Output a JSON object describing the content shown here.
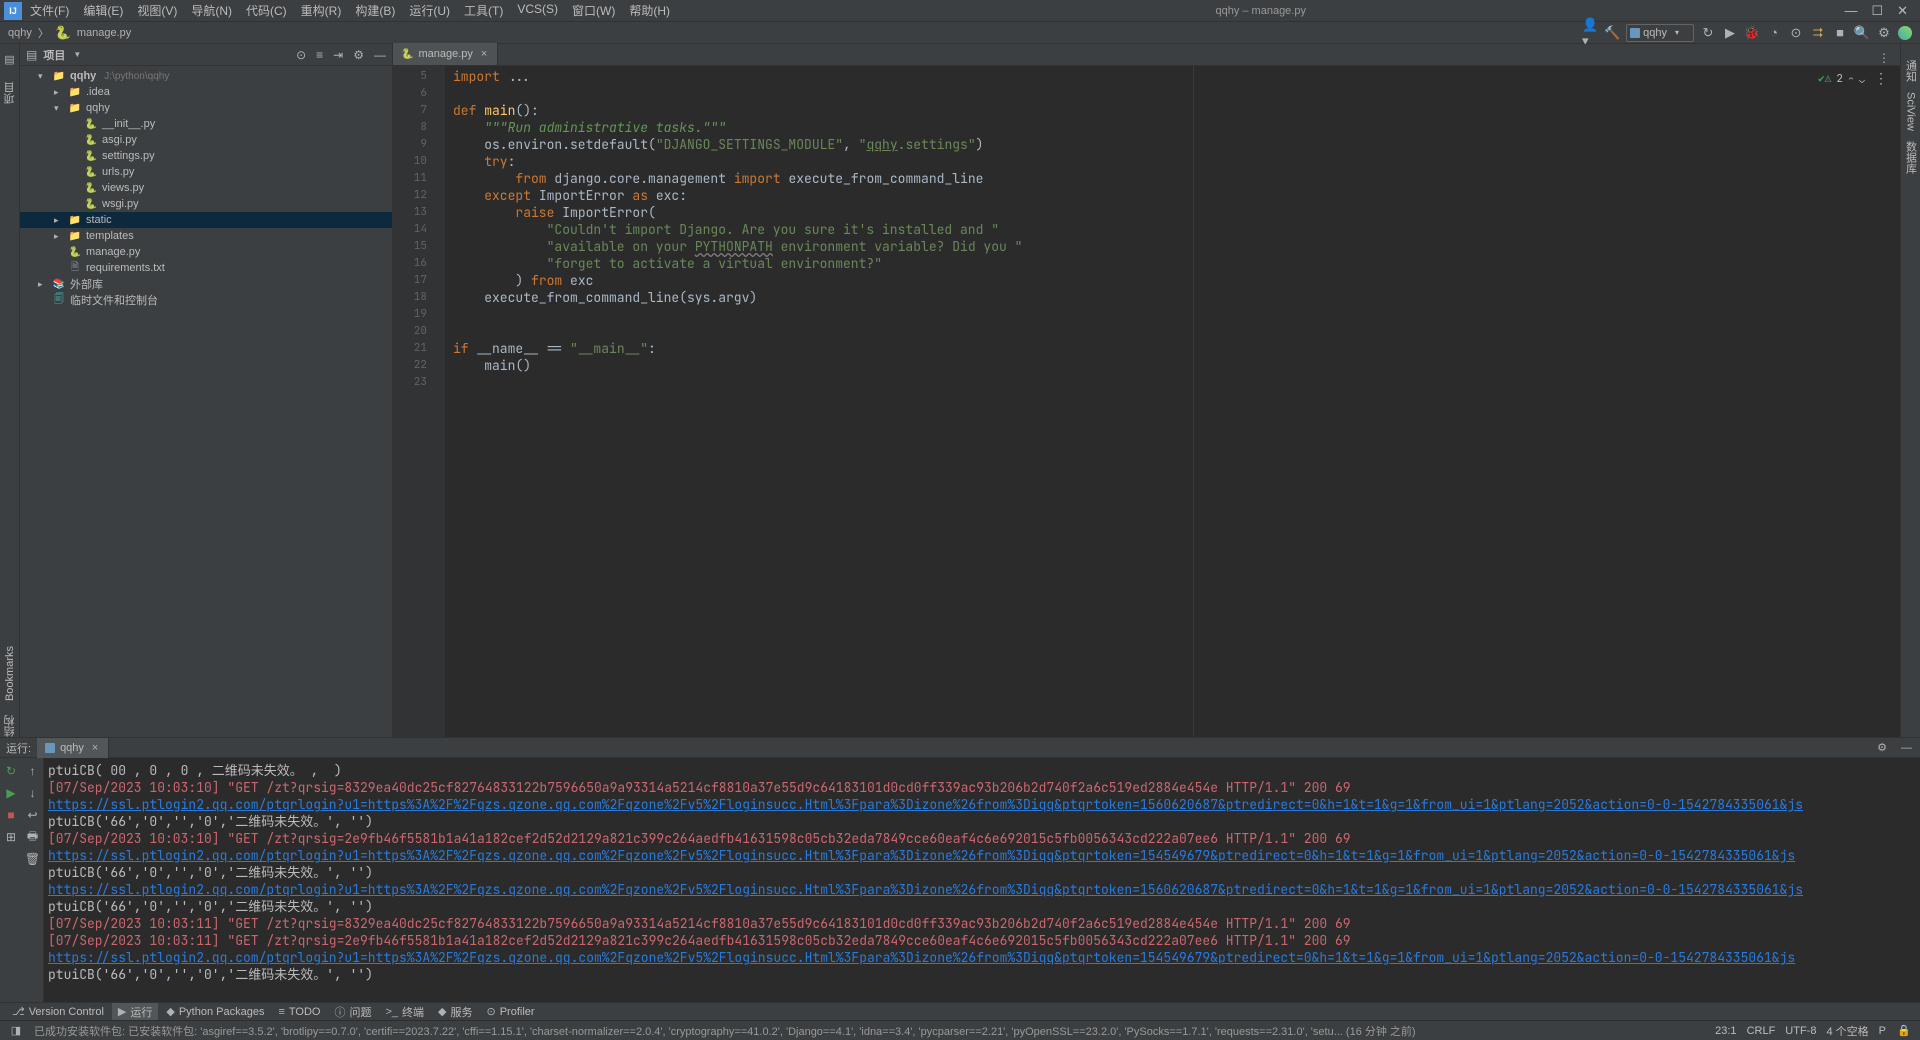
{
  "window": {
    "title": "qqhy – manage.py",
    "minimize_tooltip": "Minimize",
    "maximize_tooltip": "Maximize",
    "close_tooltip": "Close"
  },
  "menu": [
    "文件(F)",
    "编辑(E)",
    "视图(V)",
    "导航(N)",
    "代码(C)",
    "重构(R)",
    "构建(B)",
    "运行(U)",
    "工具(T)",
    "VCS(S)",
    "窗口(W)",
    "帮助(H)"
  ],
  "breadcrumb": {
    "project": "qqhy",
    "file": "manage.py"
  },
  "run_config": "qqhy",
  "project_label": "项目",
  "tree": {
    "root": {
      "name": "qqhy",
      "path": "J:\\python\\qqhy"
    },
    "idea": ".idea",
    "pkg": "qqhy",
    "pkg_files": [
      "__init__.py",
      "asgi.py",
      "settings.py",
      "urls.py",
      "views.py",
      "wsgi.py"
    ],
    "static": "static",
    "templates": "templates",
    "manage": "manage.py",
    "req": "requirements.txt",
    "ext_lib": "外部库",
    "scratches": "临时文件和控制台"
  },
  "editor": {
    "tab_label": "manage.py",
    "warn_count": "2",
    "lines": {
      "5": "import ...",
      "7": {
        "pre": "def ",
        "fn": "main",
        "post": "():"
      },
      "8": "\"\"\"Run administrative tasks.\"\"\"",
      "9": {
        "a": "os.environ.setdefault(",
        "s1": "\"DJANGO_SETTINGS_MODULE\"",
        "c": ", ",
        "s2": "\"qqhy.settings\"",
        "end": ")"
      },
      "10": "try:",
      "11": {
        "a": "from ",
        "b": "django.core.management ",
        "c": "import ",
        "d": "execute_from_command_line"
      },
      "12": {
        "a": "except ",
        "b": "ImportError ",
        "c": "as ",
        "d": "exc:"
      },
      "13": {
        "a": "raise ",
        "b": "ImportError("
      },
      "14": "\"Couldn't import Django. Are you sure it's installed and \"",
      "15": "\"available on your PYTHONPATH environment variable? Did you \"",
      "16": "\"forget to activate a virtual environment?\"",
      "17": {
        "a": ") ",
        "b": "from ",
        "c": "exc"
      },
      "18": "execute_from_command_line(sys.argv)",
      "21": {
        "a": "if ",
        "b": "__name__ ",
        "c": "== ",
        "d": "\"__main__\"",
        "e": ":"
      },
      "22": "main()"
    }
  },
  "run": {
    "label": "运行:",
    "tab": "qqhy",
    "console": [
      {
        "t": "cl",
        "v": "ptuiCB( 00 , 0 , 0 , 二维码未失效。 ,  )"
      },
      {
        "t": "red",
        "v": "[07/Sep/2023 10:03:10] \"GET /zt?qrsig=8329ea40dc25cf82764833122b7596650a9a93314a5214cf8810a37e55d9c64183101d0cd0ff339ac93b206b2d740f2a6c519ed2884e454e HTTP/1.1\" 200 69"
      },
      {
        "t": "link",
        "v": "https://ssl.ptlogin2.qq.com/ptqrlogin?u1=https%3A%2F%2Fqzs.qzone.qq.com%2Fqzone%2Fv5%2Floginsucc.Html%3Fpara%3Dizone%26from%3Diqq&ptqrtoken=1560620687&ptredirect=0&h=1&t=1&g=1&from_ui=1&ptlang=2052&action=0-0-1542784335061&js"
      },
      {
        "t": "cl",
        "v": "ptuiCB('66','0','','0','二维码未失效。', '')"
      },
      {
        "t": "red",
        "v": "[07/Sep/2023 10:03:10] \"GET /zt?qrsig=2e9fb46f5581b1a41a182cef2d52d2129a821c399c264aedfb41631598c05cb32eda7849cce60eaf4c6e692015c5fb0056343cd222a07ee6 HTTP/1.1\" 200 69"
      },
      {
        "t": "link",
        "v": "https://ssl.ptlogin2.qq.com/ptqrlogin?u1=https%3A%2F%2Fqzs.qzone.qq.com%2Fqzone%2Fv5%2Floginsucc.Html%3Fpara%3Dizone%26from%3Diqq&ptqrtoken=154549679&ptredirect=0&h=1&t=1&g=1&from_ui=1&ptlang=2052&action=0-0-1542784335061&js"
      },
      {
        "t": "cl",
        "v": "ptuiCB('66','0','','0','二维码未失效。', '')"
      },
      {
        "t": "link",
        "v": "https://ssl.ptlogin2.qq.com/ptqrlogin?u1=https%3A%2F%2Fqzs.qzone.qq.com%2Fqzone%2Fv5%2Floginsucc.Html%3Fpara%3Dizone%26from%3Diqq&ptqrtoken=1560620687&ptredirect=0&h=1&t=1&g=1&from_ui=1&ptlang=2052&action=0-0-1542784335061&js"
      },
      {
        "t": "cl",
        "v": "ptuiCB('66','0','','0','二维码未失效。', '')"
      },
      {
        "t": "red",
        "v": "[07/Sep/2023 10:03:11] \"GET /zt?qrsig=8329ea40dc25cf82764833122b7596650a9a93314a5214cf8810a37e55d9c64183101d0cd0ff339ac93b206b2d740f2a6c519ed2884e454e HTTP/1.1\" 200 69"
      },
      {
        "t": "red",
        "v": "[07/Sep/2023 10:03:11] \"GET /zt?qrsig=2e9fb46f5581b1a41a182cef2d52d2129a821c399c264aedfb41631598c05cb32eda7849cce60eaf4c6e692015c5fb0056343cd222a07ee6 HTTP/1.1\" 200 69"
      },
      {
        "t": "link",
        "v": "https://ssl.ptlogin2.qq.com/ptqrlogin?u1=https%3A%2F%2Fqzs.qzone.qq.com%2Fqzone%2Fv5%2Floginsucc.Html%3Fpara%3Dizone%26from%3Diqq&ptqrtoken=154549679&ptredirect=0&h=1&t=1&g=1&from_ui=1&ptlang=2052&action=0-0-1542784335061&js"
      },
      {
        "t": "cl",
        "v": "ptuiCB('66','0','','0','二维码未失效。', '')"
      }
    ]
  },
  "bottom_tabs": [
    {
      "icon": "⎇",
      "label": "Version Control"
    },
    {
      "icon": "▶",
      "label": "运行",
      "active": true
    },
    {
      "icon": "◆",
      "label": "Python Packages"
    },
    {
      "icon": "≡",
      "label": "TODO"
    },
    {
      "icon": "ⓘ",
      "label": "问题"
    },
    {
      "icon": ">_",
      "label": "终端"
    },
    {
      "icon": "◆",
      "label": "服务"
    },
    {
      "icon": "⊙",
      "label": "Profiler"
    }
  ],
  "status": {
    "msg": "已成功安装软件包: 已安装软件包: 'asgiref==3.5.2', 'brotlipy==0.7.0', 'certifi==2023.7.22', 'cffi==1.15.1', 'charset-normalizer==2.0.4', 'cryptography==41.0.2', 'Django==4.1', 'idna==3.4', 'pycparser==2.21', 'pyOpenSSL==23.2.0', 'PySocks==1.7.1', 'requests==2.31.0', 'setu... (16 分钟 之前)",
    "caret": "23:1",
    "le": "CRLF",
    "enc": "UTF-8",
    "indent": "4 个空格",
    "py": "P"
  },
  "left_gutter": {
    "project": "项目",
    "bookmarks": "Bookmarks",
    "structure": "结构"
  },
  "right_gutter": {
    "notif": "通知",
    "sciview": "SciView",
    "db": "数据库"
  }
}
